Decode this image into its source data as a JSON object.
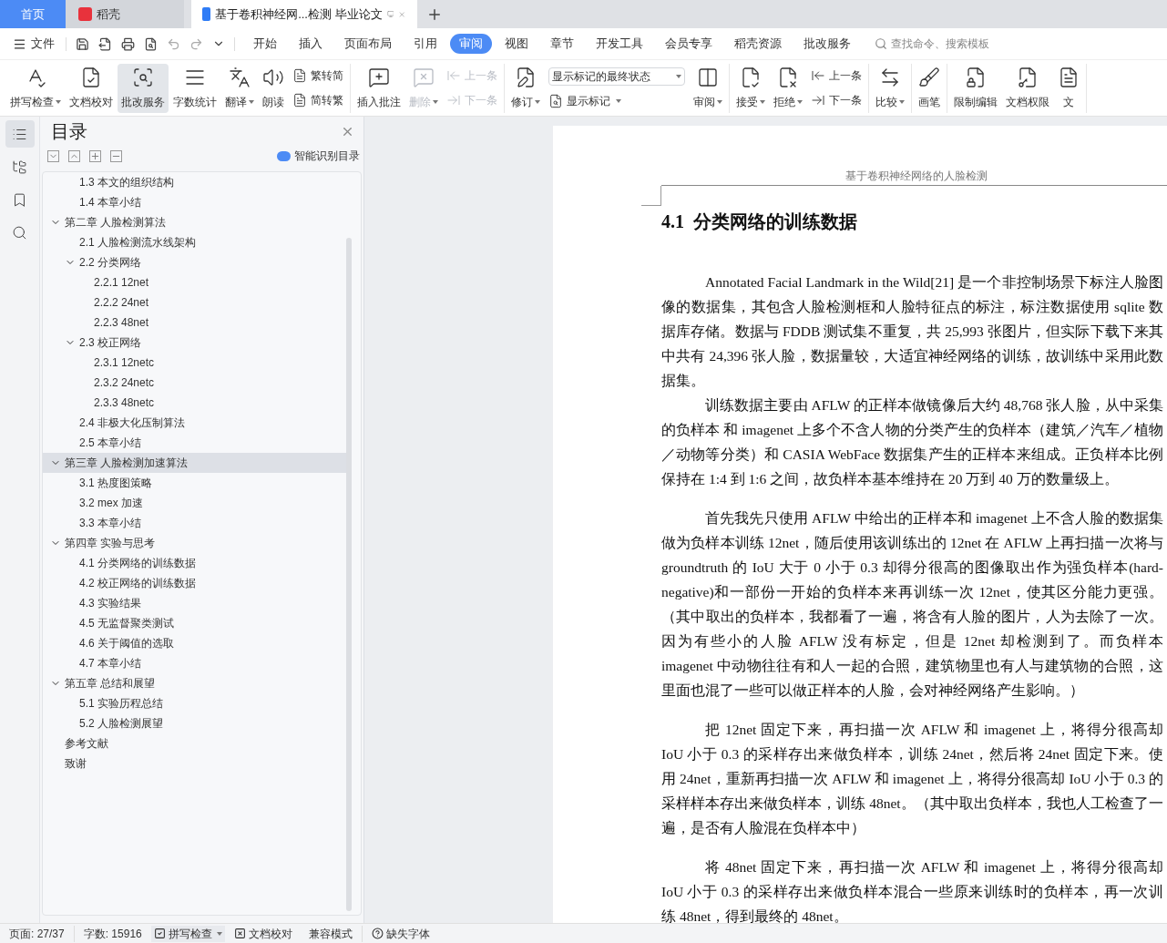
{
  "app_tabs": [
    {
      "kind": "home",
      "label": "首页",
      "selected": false
    },
    {
      "kind": "docer",
      "label": "稻壳",
      "selected": false
    },
    {
      "kind": "document",
      "label": "基于卷积神经网...检测 毕业论文",
      "selected": true
    }
  ],
  "menu": {
    "file": "文件",
    "tabs": [
      {
        "label": "开始",
        "selected": false
      },
      {
        "label": "插入",
        "selected": false
      },
      {
        "label": "页面布局",
        "selected": false
      },
      {
        "label": "引用",
        "selected": false
      },
      {
        "label": "审阅",
        "selected": true
      },
      {
        "label": "视图",
        "selected": false
      },
      {
        "label": "章节",
        "selected": false
      },
      {
        "label": "开发工具",
        "selected": false
      },
      {
        "label": "会员专享",
        "selected": false
      },
      {
        "label": "稻壳资源",
        "selected": false
      },
      {
        "label": "批改服务",
        "selected": false
      }
    ],
    "search": {
      "placeholder": "查找命令、搜索模板"
    }
  },
  "ribbon": [
    {
      "items": [
        {
          "kind": "large",
          "label": "拼写检查",
          "dropdown": true,
          "disabled": false,
          "selected": false
        },
        {
          "kind": "large",
          "label": "文档校对",
          "dropdown": false,
          "disabled": false,
          "selected": false
        },
        {
          "kind": "large",
          "label": "批改服务",
          "dropdown": false,
          "disabled": false,
          "selected": true
        },
        {
          "kind": "large",
          "label": "字数统计",
          "dropdown": false,
          "disabled": false,
          "selected": false
        },
        {
          "kind": "large",
          "label": "翻译",
          "dropdown": true,
          "disabled": false,
          "selected": false
        },
        {
          "kind": "large",
          "label": "朗读",
          "dropdown": false,
          "disabled": false,
          "selected": false
        },
        {
          "kind": "pair",
          "entries": [
            {
              "label": "繁转简",
              "disabled": false
            },
            {
              "label": "简转繁",
              "disabled": false
            }
          ]
        }
      ]
    },
    {
      "items": [
        {
          "kind": "large",
          "label": "插入批注",
          "dropdown": false,
          "disabled": false,
          "selected": false
        },
        {
          "kind": "large",
          "label": "删除",
          "dropdown": true,
          "disabled": true,
          "selected": false
        },
        {
          "kind": "pair",
          "entries": [
            {
              "label": "上一条",
              "disabled": true
            },
            {
              "label": "下一条",
              "disabled": true
            }
          ]
        }
      ]
    },
    {
      "items": [
        {
          "kind": "large",
          "label": "修订",
          "dropdown": true,
          "disabled": false,
          "selected": false
        },
        {
          "kind": "markup",
          "value": "显示标记的最终状态",
          "label": "显示标记"
        },
        {
          "kind": "large",
          "label": "审阅",
          "dropdown": true,
          "disabled": false,
          "selected": false
        }
      ]
    },
    {
      "items": [
        {
          "kind": "large",
          "label": "接受",
          "dropdown": true,
          "disabled": false,
          "selected": false
        },
        {
          "kind": "large",
          "label": "拒绝",
          "dropdown": true,
          "disabled": false,
          "selected": false
        },
        {
          "kind": "pair",
          "entries": [
            {
              "label": "上一条",
              "disabled": false
            },
            {
              "label": "下一条",
              "disabled": false
            }
          ]
        }
      ]
    },
    {
      "items": [
        {
          "kind": "large",
          "label": "比较",
          "dropdown": true,
          "disabled": false,
          "selected": false
        }
      ]
    },
    {
      "items": [
        {
          "kind": "large",
          "label": "画笔",
          "dropdown": false,
          "disabled": false,
          "selected": false
        }
      ]
    },
    {
      "items": [
        {
          "kind": "large",
          "label": "限制编辑",
          "dropdown": false,
          "disabled": false,
          "selected": false
        },
        {
          "kind": "large",
          "label": "文档权限",
          "dropdown": false,
          "disabled": false,
          "selected": false
        },
        {
          "kind": "large",
          "label": "文",
          "dropdown": false,
          "disabled": false,
          "selected": false
        }
      ]
    }
  ],
  "side_rail": [
    {
      "selected": true
    },
    {
      "selected": false
    },
    {
      "selected": false
    },
    {
      "selected": false
    }
  ],
  "toc_panel": {
    "title": "目录",
    "smart_button": "智能识别目录",
    "items": [
      {
        "children": [
          {
            "label": "1.3 本文的组织结构",
            "selected": false
          },
          {
            "label": "1.4 本章小结",
            "selected": false
          }
        ]
      },
      {
        "label": "第二章  人脸检测算法",
        "selected": false,
        "expanded": true,
        "children": [
          {
            "label": "2.1 人脸检测流水线架构",
            "selected": false
          },
          {
            "label": "2.2  分类网络",
            "selected": false,
            "expanded": true,
            "children": [
              {
                "label": "2.2.1 12net",
                "selected": false
              },
              {
                "label": "2.2.2 24net",
                "selected": false
              },
              {
                "label": "2.2.3 48net",
                "selected": false
              }
            ]
          },
          {
            "label": "2.3  校正网络",
            "selected": false,
            "expanded": true,
            "children": [
              {
                "label": "2.3.1 12netc",
                "selected": false
              },
              {
                "label": "2.3.2 24netc",
                "selected": false
              },
              {
                "label": "2.3.3 48netc",
                "selected": false
              }
            ]
          },
          {
            "label": "2.4  非极大化压制算法",
            "selected": false
          },
          {
            "label": "2.5  本章小结",
            "selected": false
          }
        ]
      },
      {
        "label": "第三章  人脸检测加速算法",
        "selected": true,
        "expanded": true,
        "children": [
          {
            "label": "3.1  热度图策略",
            "selected": false
          },
          {
            "label": "3.2 mex 加速",
            "selected": false
          },
          {
            "label": "3.3  本章小结",
            "selected": false
          }
        ]
      },
      {
        "label": "第四章  实验与思考",
        "selected": false,
        "expanded": true,
        "children": [
          {
            "label": "4.1  分类网络的训练数据",
            "selected": false
          },
          {
            "label": "4.2  校正网络的训练数据",
            "selected": false
          },
          {
            "label": "4.3  实验结果",
            "selected": false
          },
          {
            "label": "4.5  无监督聚类测试",
            "selected": false
          },
          {
            "label": "4.6 关于阈值的选取",
            "selected": false
          },
          {
            "label": "4.7  本章小结",
            "selected": false
          }
        ]
      },
      {
        "label": "第五章  总结和展望",
        "selected": false,
        "expanded": true,
        "children": [
          {
            "label": "5.1  实验历程总结",
            "selected": false
          },
          {
            "label": "5.2  人脸检测展望",
            "selected": false
          }
        ]
      },
      {
        "label": "参考文献",
        "selected": false
      },
      {
        "label": "致谢",
        "selected": false
      }
    ]
  },
  "document": {
    "header": "基于卷积神经网络的人脸检测",
    "heading": "4.1  分类网络的训练数据",
    "paragraphs": [
      "Annotated Facial Landmark in the Wild[21] 是一个非控制场景下标注人脸图像的数据集，其包含人脸检测框和人脸特征点的标注，标注数据使用 sqlite 数据库存储。数据与 FDDB 测试集不重复，共 25,993 张图片，但实际下载下来其中共有 24,396 张人脸，数据量较，大适宜神经网络的训练，故训练中采用此数据集。",
      "训练数据主要由 AFLW 的正样本做镜像后大约 48,768 张人脸，从中采集的负样本  和 imagenet 上多个不含人物的分类产生的负样本（建筑／汽车／植物／动物等分类）和  CASIA WebFace 数据集产生的正样本来组成。正负样本比例保持在 1:4 到 1:6 之间，故负样本基本维持在 20 万到 40 万的数量级上。",
      "首先我先只使用 AFLW 中给出的正样本和 imagenet 上不含人脸的数据集做为负样本训练 12net，随后使用该训练出的 12net 在 AFLW 上再扫描一次将与 groundtruth  的 IoU 大于 0 小于 0.3 却得分很高的图像取出作为强负样本(hard-negative)和一部份一开始的负样本来再训练一次 12net，使其区分能力更强。（其中取出的负样本，我都看了一遍，将含有人脸的图片，人为去除了一次。因为有些小的人脸 AFLW 没有标定，但是 12net 却检测到了。而负样本 imagenet 中动物往往有和人一起的合照，建筑物里也有人与建筑物的合照，这里面也混了一些可以做正样本的人脸，会对神经网络产生影响。）",
      "把 12net 固定下来，再扫描一次 AFLW 和 imagenet 上，将得分很高却 IoU 小于 0.3 的采样存出来做负样本，训练 24net，然后将 24net 固定下来。使用 24net，重新再扫描一次 AFLW 和 imagenet 上，将得分很高却 IoU 小于 0.3 的采样样本存出来做负样本，训练 48net。（其中取出负样本，我也人工检查了一遍，是否有人脸混在负样本中）",
      "将 48net 固定下来，再扫描一次 AFLW 和 imagenet 上，将得分很高却 IoU 小于 0.3 的采样存出来做负样本混合一些原来训练时的负样本，再一次训练 48net，得到最终的 48net。"
    ]
  },
  "status_bar": {
    "page": "页面: 27/37",
    "words": "字数: 15916",
    "spell_check": "拼写检查",
    "proofread": "文档校对",
    "compat": "兼容模式",
    "missing_fonts": "缺失字体"
  }
}
